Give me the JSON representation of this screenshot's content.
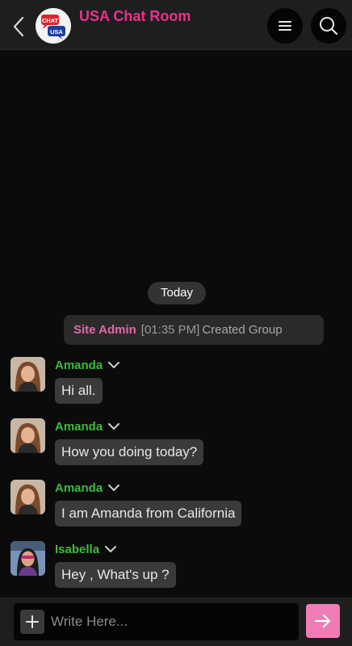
{
  "header": {
    "title": "USA Chat Room",
    "logo": {
      "top_text": "CHAT",
      "bottom_text": "USA"
    },
    "icons": {
      "back": "chevron-left-icon",
      "menu": "hamburger-menu-icon",
      "search": "search-icon"
    }
  },
  "chat": {
    "date_label": "Today",
    "system_message": {
      "sender": "Site Admin",
      "time": "[01:35 PM]",
      "text": "Created Group"
    },
    "messages": [
      {
        "sender": "Amanda",
        "text": "Hi all."
      },
      {
        "sender": "Amanda",
        "text": "How you doing today?"
      },
      {
        "sender": "Amanda",
        "text": "I am Amanda from California"
      },
      {
        "sender": "Isabella",
        "text": "Hey , What's up ?"
      }
    ]
  },
  "composer": {
    "placeholder": "Write Here...",
    "value": "",
    "icons": {
      "attach": "plus-icon",
      "send": "arrow-right-icon"
    }
  },
  "colors": {
    "brand_pink": "#e8338d",
    "send_pink": "#f07cb5",
    "sender_green": "#3dba3d",
    "background": "#0b0b0b"
  }
}
